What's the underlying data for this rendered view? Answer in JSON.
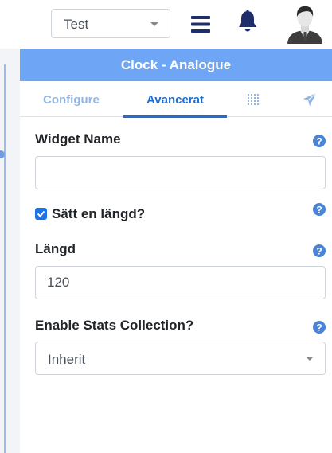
{
  "navbar": {
    "layout_select_value": "Test",
    "menu_icon": "hamburger-menu-icon",
    "notification_icon": "bell-icon",
    "avatar_icon": "user-avatar"
  },
  "panel": {
    "title": "Clock - Analogue",
    "tabs": [
      {
        "label": "Configure",
        "active": false
      },
      {
        "label": "Avancerat",
        "active": true
      },
      {
        "label": "",
        "icon": "grid-icon"
      },
      {
        "label": "",
        "icon": "send-icon"
      }
    ]
  },
  "form": {
    "widget_name_label": "Widget Name",
    "widget_name_value": "",
    "set_duration_label": "Sätt en längd?",
    "set_duration_checked": true,
    "duration_label": "Längd",
    "duration_value": "120",
    "stats_label": "Enable Stats Collection?",
    "stats_value": "Inherit",
    "help_icon": "question-circle-icon"
  },
  "colors": {
    "header_bg": "#6ea6f5",
    "active_tab": "#1e6fcf",
    "inactive_tab": "#8fb6e6",
    "navy_icons": "#1f2d6b",
    "help_icon": "#4a84d6",
    "checkbox": "#1a73e8"
  }
}
